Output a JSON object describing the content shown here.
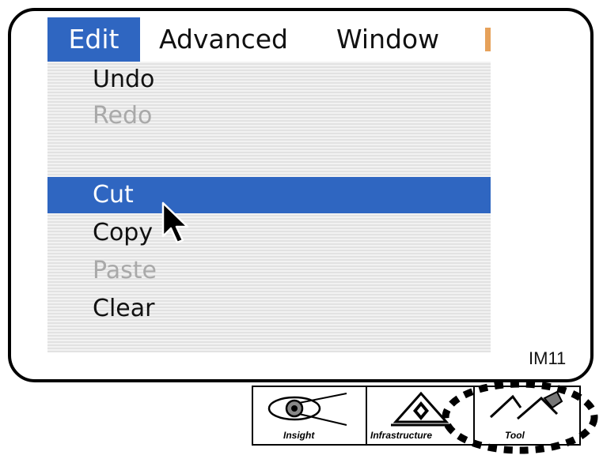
{
  "menubar": {
    "items": [
      {
        "label": "Edit"
      },
      {
        "label": "Advanced"
      },
      {
        "label": "Window"
      }
    ]
  },
  "dropdown": {
    "items": [
      {
        "label": "Undo",
        "enabled": true
      },
      {
        "label": "Redo",
        "enabled": false
      },
      {
        "label": "Cut",
        "enabled": true,
        "selected": true
      },
      {
        "label": "Copy",
        "enabled": true
      },
      {
        "label": "Paste",
        "enabled": false
      },
      {
        "label": "Clear",
        "enabled": true
      }
    ]
  },
  "figure_label": "IM11",
  "icons": {
    "insight": {
      "label": "Insight",
      "icon": "eye-target-icon"
    },
    "infrastructure": {
      "label": "Infrastructure",
      "icon": "diamond-pyramid-icon"
    },
    "tool": {
      "label": "Tool",
      "icon": "tool-pick-icon"
    }
  },
  "colors": {
    "selection": "#2f66c1",
    "disabled_text": "#a9a9a9"
  }
}
